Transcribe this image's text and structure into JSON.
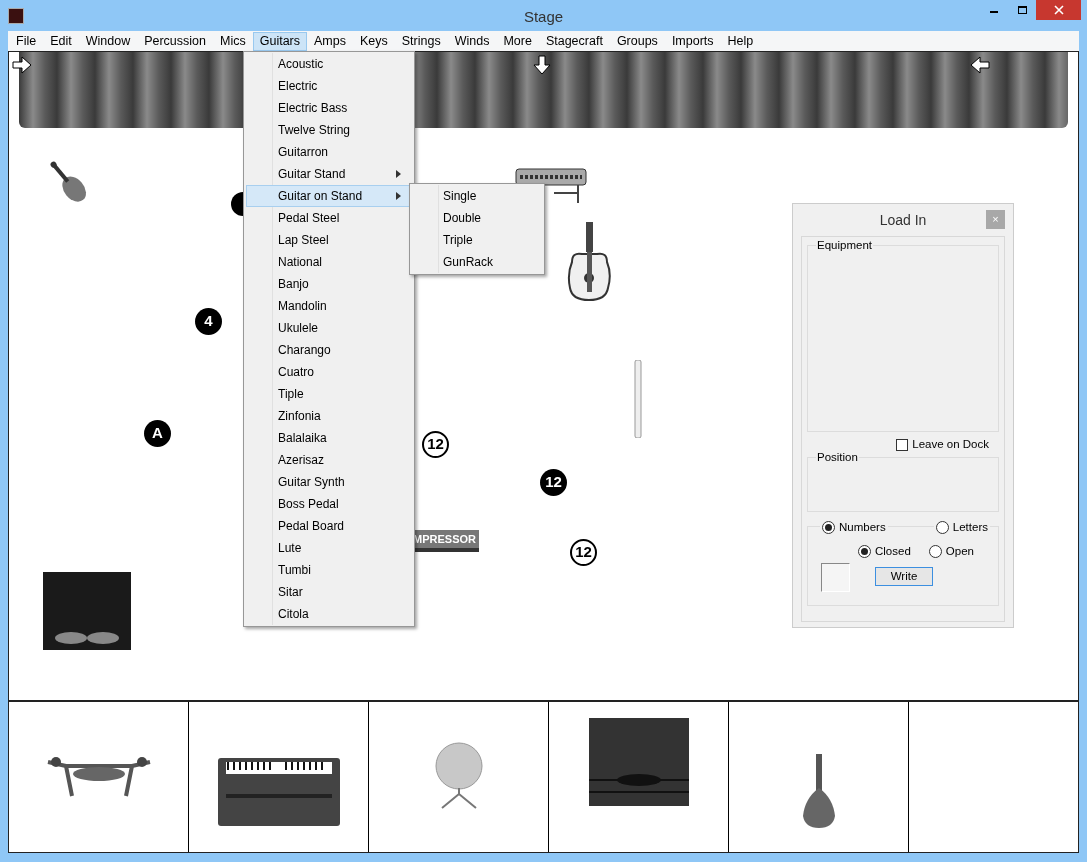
{
  "window": {
    "title": "Stage"
  },
  "menu": [
    {
      "label": "File",
      "selected": false
    },
    {
      "label": "Edit",
      "selected": false
    },
    {
      "label": "Window",
      "selected": false
    },
    {
      "label": "Percussion",
      "selected": false
    },
    {
      "label": "Mics",
      "selected": false
    },
    {
      "label": "Guitars",
      "selected": true
    },
    {
      "label": "Amps",
      "selected": false
    },
    {
      "label": "Keys",
      "selected": false
    },
    {
      "label": "Strings",
      "selected": false
    },
    {
      "label": "Winds",
      "selected": false
    },
    {
      "label": "More",
      "selected": false
    },
    {
      "label": "Stagecraft",
      "selected": false
    },
    {
      "label": "Groups",
      "selected": false
    },
    {
      "label": "Imports",
      "selected": false
    },
    {
      "label": "Help",
      "selected": false
    }
  ],
  "guitars_menu": [
    {
      "label": "Acoustic",
      "submenu": false,
      "selected": false
    },
    {
      "label": "Electric",
      "submenu": false,
      "selected": false
    },
    {
      "label": "Electric Bass",
      "submenu": false,
      "selected": false
    },
    {
      "label": "Twelve String",
      "submenu": false,
      "selected": false
    },
    {
      "label": "Guitarron",
      "submenu": false,
      "selected": false
    },
    {
      "label": "Guitar Stand",
      "submenu": true,
      "selected": false
    },
    {
      "label": "Guitar on Stand",
      "submenu": true,
      "selected": true
    },
    {
      "label": "Pedal Steel",
      "submenu": false,
      "selected": false
    },
    {
      "label": "Lap Steel",
      "submenu": false,
      "selected": false
    },
    {
      "label": "National",
      "submenu": false,
      "selected": false
    },
    {
      "label": "Banjo",
      "submenu": false,
      "selected": false
    },
    {
      "label": "Mandolin",
      "submenu": false,
      "selected": false
    },
    {
      "label": "Ukulele",
      "submenu": false,
      "selected": false
    },
    {
      "label": "Charango",
      "submenu": false,
      "selected": false
    },
    {
      "label": "Cuatro",
      "submenu": false,
      "selected": false
    },
    {
      "label": "Tiple",
      "submenu": false,
      "selected": false
    },
    {
      "label": "Zinfonia",
      "submenu": false,
      "selected": false
    },
    {
      "label": "Balalaika",
      "submenu": false,
      "selected": false
    },
    {
      "label": "Azerisaz",
      "submenu": false,
      "selected": false
    },
    {
      "label": "Guitar Synth",
      "submenu": false,
      "selected": false
    },
    {
      "label": "Boss Pedal",
      "submenu": false,
      "selected": false
    },
    {
      "label": "Pedal Board",
      "submenu": false,
      "selected": false
    },
    {
      "label": "Lute",
      "submenu": false,
      "selected": false
    },
    {
      "label": "Tumbi",
      "submenu": false,
      "selected": false
    },
    {
      "label": "Sitar",
      "submenu": false,
      "selected": false
    },
    {
      "label": "Citola",
      "submenu": false,
      "selected": false
    }
  ],
  "submenu": [
    "Single",
    "Double",
    "Triple",
    "GunRack"
  ],
  "stage": {
    "markers": [
      {
        "label": "4",
        "kind": "filled"
      },
      {
        "label": "A",
        "kind": "filled"
      },
      {
        "label": "12",
        "kind": "outline"
      },
      {
        "label": "12",
        "kind": "filled"
      },
      {
        "label": "12",
        "kind": "outline"
      }
    ],
    "compressor_label": "MPRESSOR"
  },
  "load_in": {
    "title": "Load In",
    "close": "×",
    "equipment_label": "Equipment",
    "leave_on_dock": {
      "label": "Leave on Dock",
      "checked": false
    },
    "position_label": "Position",
    "radios_1": [
      {
        "label": "Numbers",
        "selected": true
      },
      {
        "label": "Letters",
        "selected": false
      }
    ],
    "radios_2": [
      {
        "label": "Closed",
        "selected": true
      },
      {
        "label": "Open",
        "selected": false
      }
    ],
    "write_button": "Write"
  }
}
